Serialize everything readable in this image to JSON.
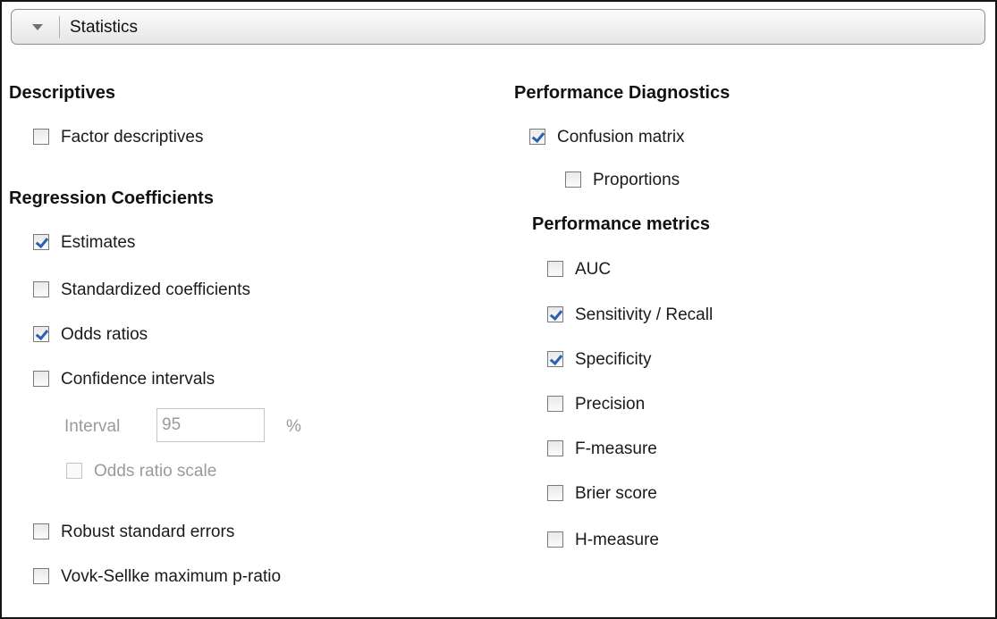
{
  "section": {
    "title": "Statistics",
    "expanded": true
  },
  "descriptives": {
    "heading": "Descriptives",
    "factor_descriptives": {
      "label": "Factor descriptives",
      "checked": false
    }
  },
  "regression": {
    "heading": "Regression Coefficients",
    "estimates": {
      "label": "Estimates",
      "checked": true
    },
    "standardized": {
      "label": "Standardized coefficients",
      "checked": false
    },
    "odds_ratios": {
      "label": "Odds ratios",
      "checked": true
    },
    "confidence_intervals": {
      "label": "Confidence intervals",
      "checked": false
    },
    "interval": {
      "label": "Interval",
      "value": "95",
      "unit": "%",
      "enabled": false
    },
    "odds_ratio_scale": {
      "label": "Odds ratio scale",
      "checked": false,
      "enabled": false
    },
    "robust_se": {
      "label": "Robust standard errors",
      "checked": false
    },
    "vovk_sellke": {
      "label": "Vovk-Sellke maximum p-ratio",
      "checked": false
    }
  },
  "performance_diagnostics": {
    "heading": "Performance Diagnostics",
    "confusion_matrix": {
      "label": "Confusion matrix",
      "checked": true
    },
    "proportions": {
      "label": "Proportions",
      "checked": false
    }
  },
  "performance_metrics": {
    "heading": "Performance metrics",
    "auc": {
      "label": "AUC",
      "checked": false
    },
    "sensitivity": {
      "label": "Sensitivity / Recall",
      "checked": true
    },
    "specificity": {
      "label": "Specificity",
      "checked": true
    },
    "precision": {
      "label": "Precision",
      "checked": false
    },
    "f_measure": {
      "label": "F-measure",
      "checked": false
    },
    "brier_score": {
      "label": "Brier score",
      "checked": false
    },
    "h_measure": {
      "label": "H-measure",
      "checked": false
    }
  },
  "colors": {
    "check_mark": "#2b5fb0",
    "disabled_text": "#9a9a9a",
    "frame_border": "#141414"
  }
}
